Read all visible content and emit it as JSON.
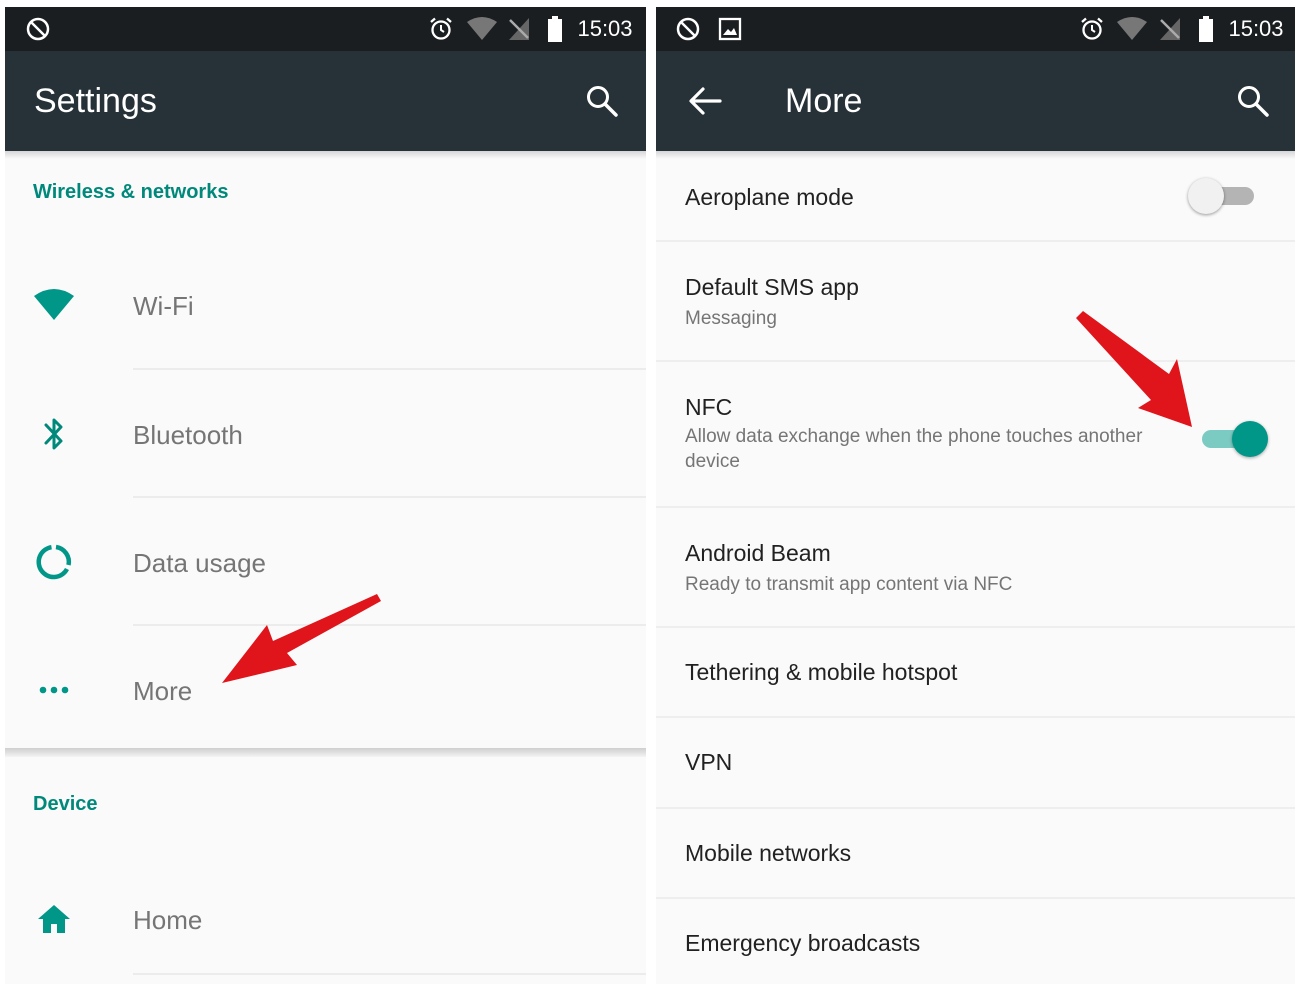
{
  "status_bar": {
    "time": "15:03"
  },
  "left": {
    "title": "Settings",
    "sections": [
      {
        "header": "Wireless & networks",
        "items": [
          {
            "label": "Wi-Fi",
            "icon": "wifi-icon"
          },
          {
            "label": "Bluetooth",
            "icon": "bluetooth-icon"
          },
          {
            "label": "Data usage",
            "icon": "data-usage-icon"
          },
          {
            "label": "More",
            "icon": "more-dots-icon"
          }
        ]
      },
      {
        "header": "Device",
        "items": [
          {
            "label": "Home",
            "icon": "home-icon"
          }
        ]
      }
    ]
  },
  "right": {
    "title": "More",
    "items": [
      {
        "title": "Aeroplane mode",
        "switch": "off"
      },
      {
        "title": "Default SMS app",
        "subtitle": "Messaging"
      },
      {
        "title": "NFC",
        "subtitle": "Allow data exchange when the phone touches another device",
        "switch": "on"
      },
      {
        "title": "Android Beam",
        "subtitle": "Ready to transmit app content via NFC"
      },
      {
        "title": "Tethering & mobile hotspot"
      },
      {
        "title": "VPN"
      },
      {
        "title": "Mobile networks"
      },
      {
        "title": "Emergency broadcasts"
      }
    ]
  },
  "colors": {
    "status_bar": "#1a1e21",
    "app_bar": "#263238",
    "accent": "#009688",
    "section_header": "#00897b",
    "annotation_arrow": "#e0141b"
  }
}
